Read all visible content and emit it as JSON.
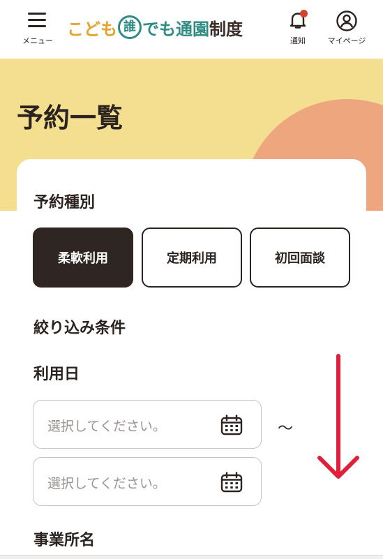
{
  "header": {
    "menu_label": "メニュー",
    "logo": {
      "part1": "こども",
      "circle_char": "誰",
      "part2": "でも",
      "part3": "通園",
      "part4": "制度"
    },
    "notifications_label": "通知",
    "mypage_label": "マイページ"
  },
  "page": {
    "title": "予約一覧"
  },
  "reservation_type": {
    "label": "予約種別",
    "options": [
      "柔軟利用",
      "定期利用",
      "初回面談"
    ],
    "selected_index": 0
  },
  "filters": {
    "heading": "絞り込み条件",
    "usage_date": {
      "label": "利用日",
      "from_placeholder": "選択してください。",
      "to_placeholder": "選択してください。",
      "separator": "～"
    },
    "facility_name_label": "事業所名"
  },
  "colors": {
    "hero_yellow": "#f3df8f",
    "hero_orange": "#eea67e",
    "selected_dark": "#2f2623",
    "notification_dot": "#d8402b",
    "scroll_arrow": "#e0203a",
    "logo_orange": "#e2a42d",
    "logo_teal": "#2f8c84"
  },
  "icons": {
    "menu": "hamburger-icon",
    "notifications": "bell-icon",
    "mypage": "user-circle-icon",
    "calendar": "calendar-icon",
    "overlay": "down-arrow-icon"
  }
}
